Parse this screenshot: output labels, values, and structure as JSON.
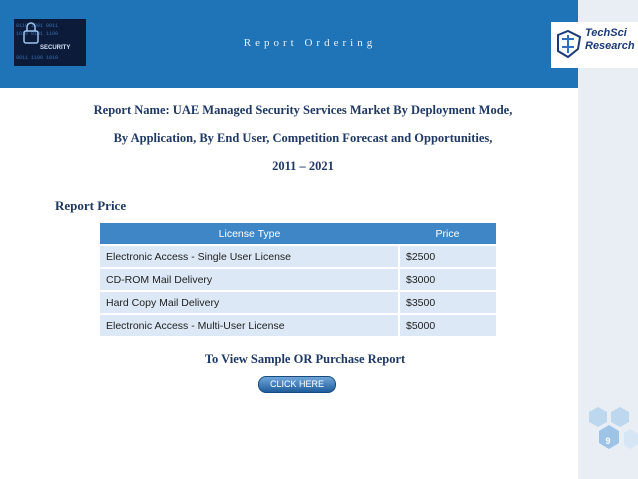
{
  "header": {
    "title": "Report Ordering"
  },
  "logo": {
    "line1": "TechSci",
    "line2": "Research"
  },
  "security_thumb": {
    "label": "SECURITY"
  },
  "report_name_lines": [
    "Report Name: UAE Managed Security Services Market By Deployment Mode,",
    "By Application, By End User, Competition Forecast and Opportunities,",
    "2011 – 2021"
  ],
  "price_heading": "Report Price",
  "price_table": {
    "headers": {
      "type": "License Type",
      "price": "Price"
    },
    "rows": [
      {
        "type": "Electronic Access - Single User License",
        "price": "$2500"
      },
      {
        "type": "CD-ROM Mail Delivery",
        "price": "$3000"
      },
      {
        "type": "Hard Copy Mail Delivery",
        "price": "$3500"
      },
      {
        "type": "Electronic Access - Multi-User License",
        "price": "$5000"
      }
    ]
  },
  "cta": {
    "text": "To View Sample OR Purchase Report",
    "button": "CLICK HERE"
  },
  "page_number": "9",
  "colors": {
    "band": "#1E74B6",
    "text_dark": "#1F3864",
    "table_header": "#3F86C7",
    "table_row": "#DCE8F5",
    "hex": "#BDD7EE"
  }
}
